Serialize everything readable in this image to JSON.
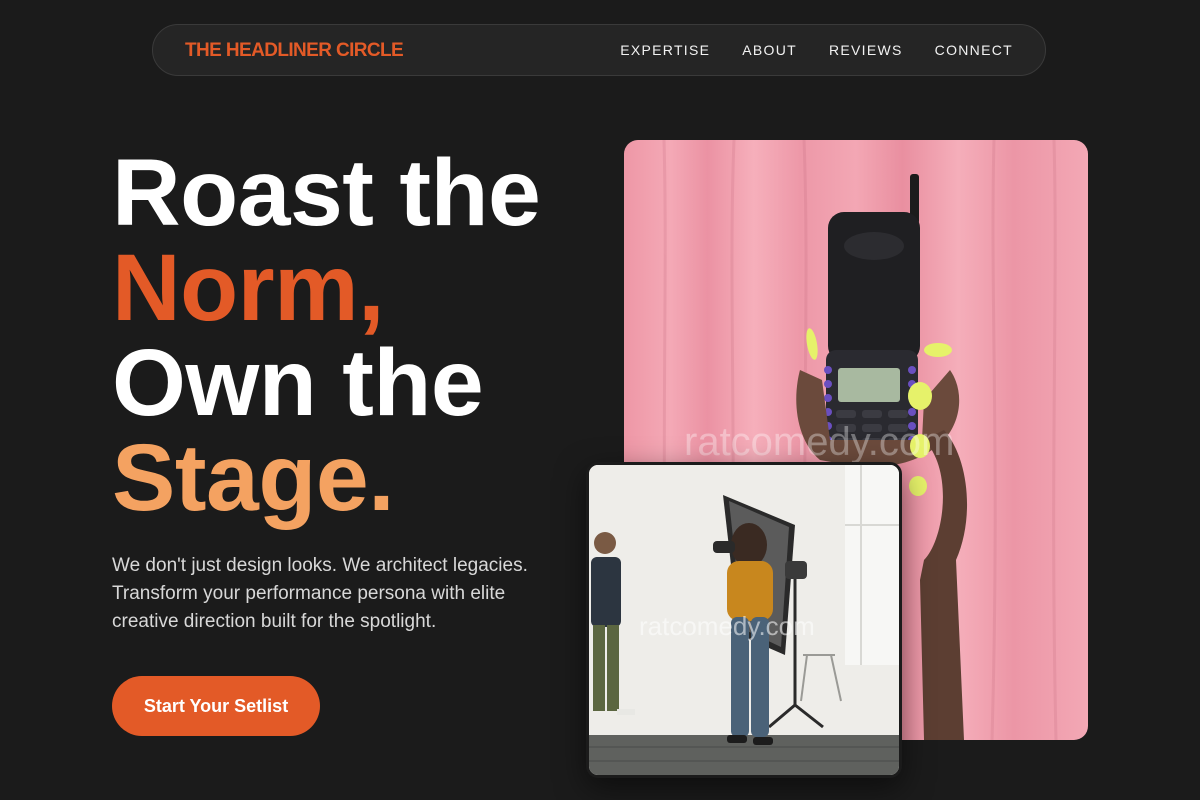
{
  "nav": {
    "brand": "THE HEADLINER CIRCLE",
    "links": [
      "EXPERTISE",
      "ABOUT",
      "REVIEWS",
      "CONNECT"
    ]
  },
  "hero": {
    "headline": {
      "line1": "Roast the",
      "line2": "Norm,",
      "line3": "Own the",
      "line4": "Stage."
    },
    "subtitle": "We don't just design looks. We architect legacies. Transform your performance persona with elite creative direction built for the spotlight.",
    "cta_label": "Start Your Setlist"
  },
  "images": {
    "main_watermark": "ratcomedy.com",
    "secondary_watermark": "ratcomedy.com"
  },
  "colors": {
    "background": "#1b1b1b",
    "accent": "#e35a27",
    "accent_light": "#f4a261",
    "text": "#ffffff"
  }
}
